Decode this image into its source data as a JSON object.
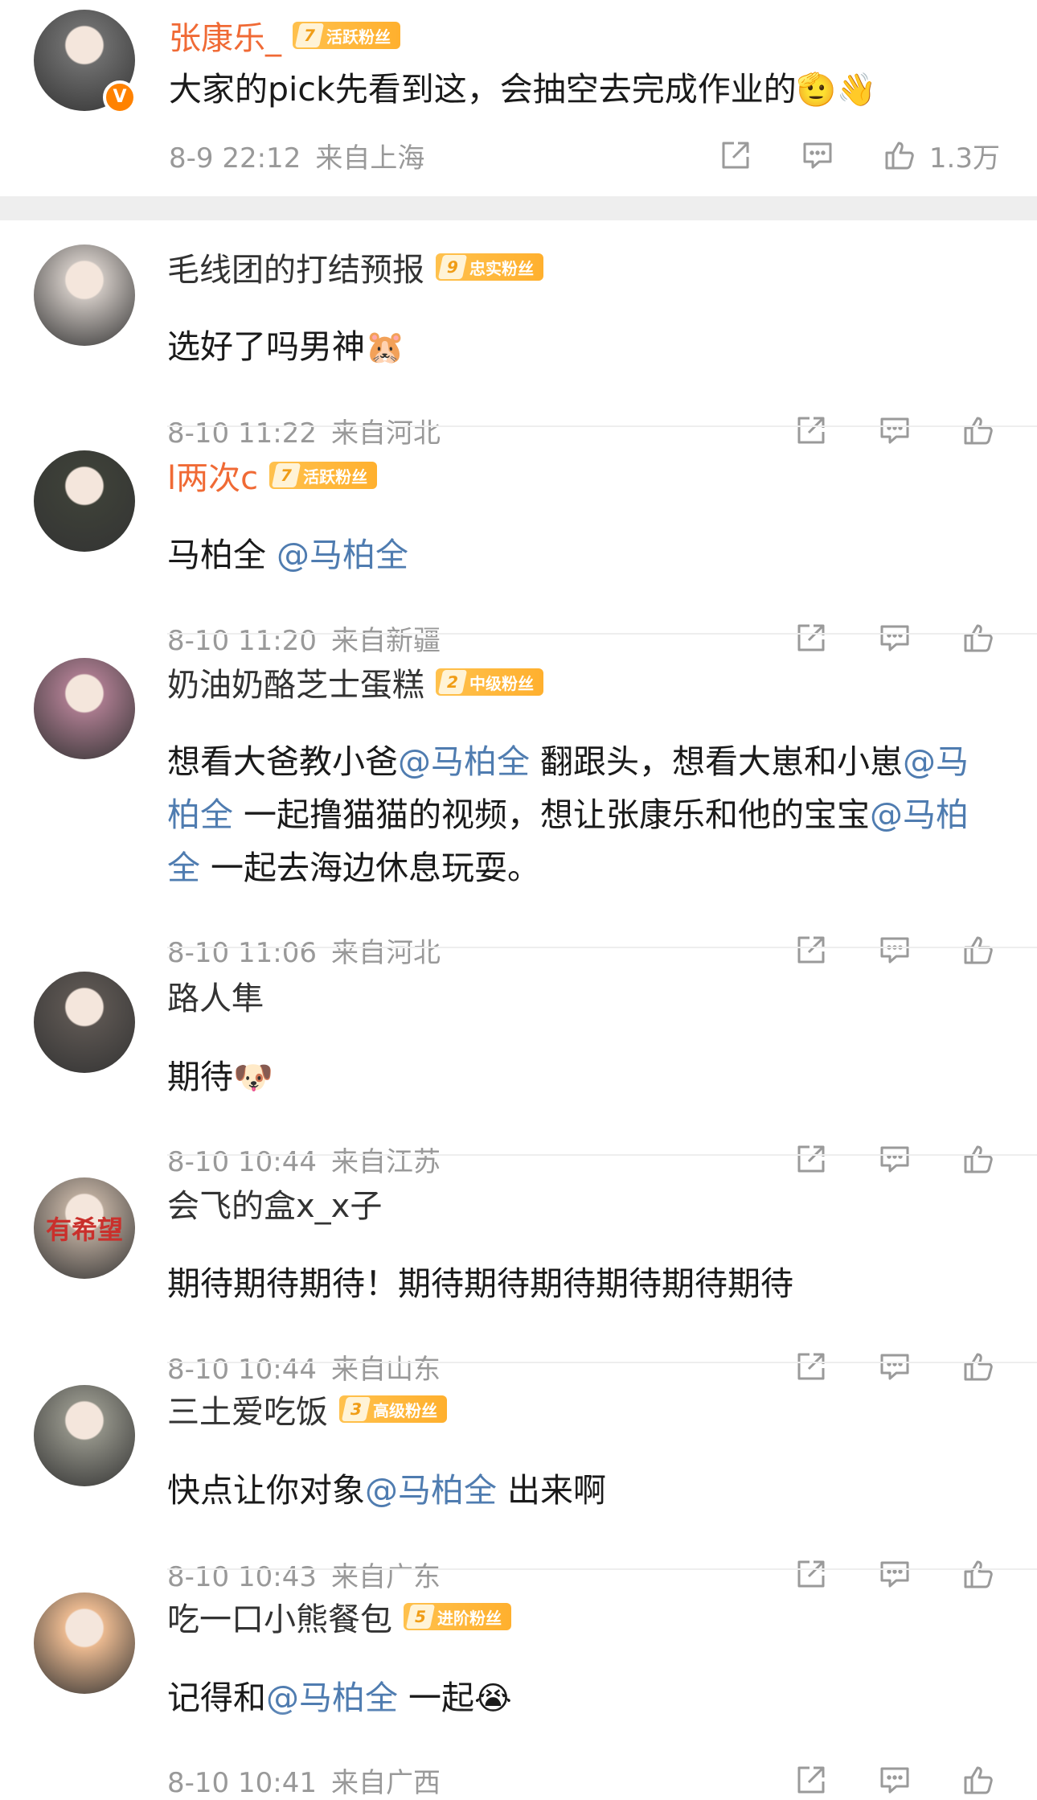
{
  "comments": [
    {
      "user": "张康乐_",
      "name_color": "#f06a35",
      "verified": true,
      "fan_badge": {
        "level": "7",
        "label": "活跃粉丝"
      },
      "segments": [
        {
          "t": "大家的pick先看到这，会抽空去完成作业的"
        },
        {
          "t": "🫡👋",
          "emoji": true
        }
      ],
      "time": "8-9 22:12",
      "location": "来自上海",
      "like_count": "1.3万",
      "avatar_color": "#6d6d6d"
    },
    {
      "user": "毛线团的打结预报",
      "fan_badge": {
        "level": "9",
        "label": "忠实粉丝"
      },
      "segments": [
        {
          "t": "选好了吗男神"
        },
        {
          "t": "🐹",
          "emoji": true
        }
      ],
      "time": "8-10 11:22",
      "location": "来自河北",
      "like_count": "",
      "avatar_color": "#c9c2bd"
    },
    {
      "user": "l两次c",
      "name_color": "#f06a35",
      "fan_badge": {
        "level": "7",
        "label": "活跃粉丝"
      },
      "segments": [
        {
          "t": "马柏全 "
        },
        {
          "t": "@马柏全",
          "mention": true
        }
      ],
      "time": "8-10 11:20",
      "location": "来自新疆",
      "like_count": "",
      "avatar_color": "#3d4038"
    },
    {
      "user": "奶油奶酪芝士蛋糕",
      "fan_badge": {
        "level": "2",
        "label": "中级粉丝"
      },
      "segments": [
        {
          "t": "想看大爸教小爸"
        },
        {
          "t": "@马柏全",
          "mention": true
        },
        {
          "t": " 翻跟头，想看大崽和小崽"
        },
        {
          "t": "@马柏全",
          "mention": true
        },
        {
          "t": " 一起撸猫猫的视频，想让张康乐和他的宝宝"
        },
        {
          "t": "@马柏全",
          "mention": true
        },
        {
          "t": " 一起去海边休息玩耍。"
        }
      ],
      "time": "8-10 11:06",
      "location": "来自河北",
      "like_count": "",
      "avatar_color": "#a7798c"
    },
    {
      "user": "路人隼",
      "segments": [
        {
          "t": "期待"
        },
        {
          "t": "🐶",
          "emoji": true
        }
      ],
      "time": "8-10 10:44",
      "location": "来自江苏",
      "like_count": "",
      "avatar_color": "#5a5450"
    },
    {
      "user": "会飞的盒x_x子",
      "segments": [
        {
          "t": "期待期待期待！期待期待期待期待期待期待"
        }
      ],
      "time": "8-10 10:44",
      "location": "来自山东",
      "like_count": "",
      "avatar_color": "#b8a89a",
      "avatar_text": "有希望"
    },
    {
      "user": "三土爱吃饭",
      "fan_badge": {
        "level": "3",
        "label": "高级粉丝"
      },
      "segments": [
        {
          "t": "快点让你对象"
        },
        {
          "t": "@马柏全",
          "mention": true
        },
        {
          "t": " 出来啊"
        }
      ],
      "time": "8-10 10:43",
      "location": "来自广东",
      "like_count": "",
      "avatar_color": "#8f8f85"
    },
    {
      "user": "吃一口小熊餐包",
      "fan_badge": {
        "level": "5",
        "label": "进阶粉丝"
      },
      "segments": [
        {
          "t": "记得和"
        },
        {
          "t": "@马柏全",
          "mention": true
        },
        {
          "t": " 一起"
        },
        {
          "t": "😭",
          "emoji": true
        }
      ],
      "time": "8-10 10:41",
      "location": "来自广西",
      "like_count": "",
      "avatar_color": "#e9b88f"
    }
  ],
  "icons": {
    "share": "share-icon",
    "reply": "comment-icon",
    "like": "thumbs-up-icon",
    "verified": "verified-v-icon"
  },
  "colors": {
    "mention": "#4f7cb0",
    "meta": "#999999",
    "badge": "#ffb02e",
    "orange_name": "#f06a35"
  }
}
